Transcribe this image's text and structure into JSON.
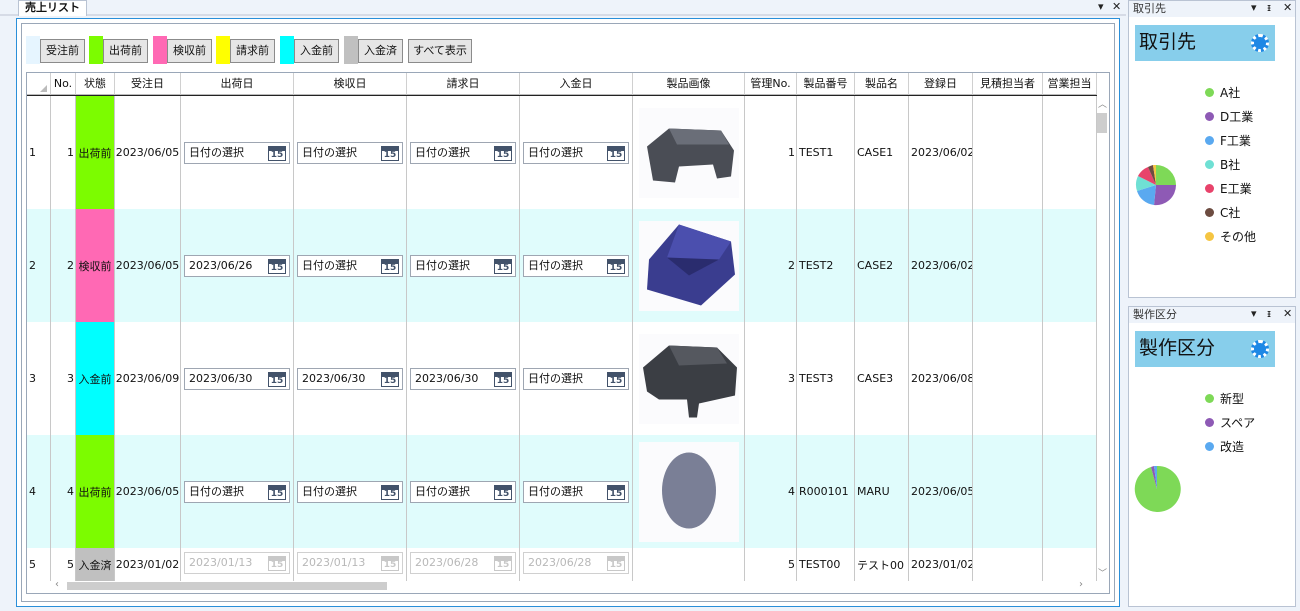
{
  "tab": {
    "title": "売上リスト"
  },
  "filters": [
    {
      "swatch": "#e6f5ff",
      "label": "受注前"
    },
    {
      "swatch": "#7cfc00",
      "label": "出荷前"
    },
    {
      "swatch": "#ff69b4",
      "label": "検収前"
    },
    {
      "swatch": "#ffff00",
      "label": "請求前"
    },
    {
      "swatch": "#00ffff",
      "label": "入金前"
    },
    {
      "swatch": "#c0c0c0",
      "label": "入金済"
    }
  ],
  "show_all_label": "すべて表示",
  "columns": [
    "No.",
    "状態",
    "受注日",
    "出荷日",
    "検収日",
    "請求日",
    "入金日",
    "製品画像",
    "管理No.",
    "製品番号",
    "製品名",
    "登録日",
    "見積担当者",
    "営業担当"
  ],
  "rows": [
    {
      "rowhdr": "1",
      "no": "1",
      "status": "出荷前",
      "status_color": "#7cfc00",
      "order": "2023/06/05",
      "ship": "日付の選択",
      "inspect": "日付の選択",
      "bill": "日付の選択",
      "pay": "日付の選択",
      "image": "gray-case",
      "mgmt": "1",
      "pnum": "TEST1",
      "pname": "CASE1",
      "reg": "2023/06/02"
    },
    {
      "rowhdr": "2",
      "no": "2",
      "status": "検収前",
      "status_color": "#ff69b4",
      "order": "2023/06/05",
      "ship": "2023/06/26",
      "inspect": "日付の選択",
      "bill": "日付の選択",
      "pay": "日付の選択",
      "image": "blue-case",
      "mgmt": "2",
      "pnum": "TEST2",
      "pname": "CASE2",
      "reg": "2023/06/02"
    },
    {
      "rowhdr": "3",
      "no": "3",
      "status": "入金前",
      "status_color": "#00ffff",
      "order": "2023/06/09",
      "ship": "2023/06/30",
      "inspect": "2023/06/30",
      "bill": "2023/06/30",
      "pay": "日付の選択",
      "image": "dark-case",
      "mgmt": "3",
      "pnum": "TEST3",
      "pname": "CASE3",
      "reg": "2023/06/08"
    },
    {
      "rowhdr": "4",
      "no": "4",
      "status": "出荷前",
      "status_color": "#7cfc00",
      "order": "2023/06/05",
      "ship": "日付の選択",
      "inspect": "日付の選択",
      "bill": "日付の選択",
      "pay": "日付の選択",
      "image": "disc",
      "mgmt": "4",
      "pnum": "R000101",
      "pname": "MARU",
      "reg": "2023/06/05"
    },
    {
      "rowhdr": "5",
      "no": "5",
      "status": "入金済",
      "status_color": "#c0c0c0",
      "order": "2023/01/02",
      "ship": "2023/01/13",
      "inspect": "2023/01/13",
      "bill": "2023/06/28",
      "pay": "2023/06/28",
      "image": "",
      "mgmt": "5",
      "pnum": "TEST00",
      "pname": "テスト00",
      "reg": "2023/01/02"
    }
  ],
  "cal_day": "15",
  "panels": [
    {
      "title": "取引先",
      "heading": "取引先",
      "legend": [
        {
          "label": "A社",
          "color": "#7ed957"
        },
        {
          "label": "D工業",
          "color": "#8e5ab5"
        },
        {
          "label": "F工業",
          "color": "#5aa9f0"
        },
        {
          "label": "B社",
          "color": "#6fe0d4"
        },
        {
          "label": "E工業",
          "color": "#e8436b"
        },
        {
          "label": "C社",
          "color": "#6d4c41"
        },
        {
          "label": "その他",
          "color": "#f5c542"
        }
      ]
    },
    {
      "title": "製作区分",
      "heading": "製作区分",
      "legend": [
        {
          "label": "新型",
          "color": "#7ed957"
        },
        {
          "label": "スペア",
          "color": "#8e5ab5"
        },
        {
          "label": "改造",
          "color": "#5aa9f0"
        }
      ]
    }
  ]
}
